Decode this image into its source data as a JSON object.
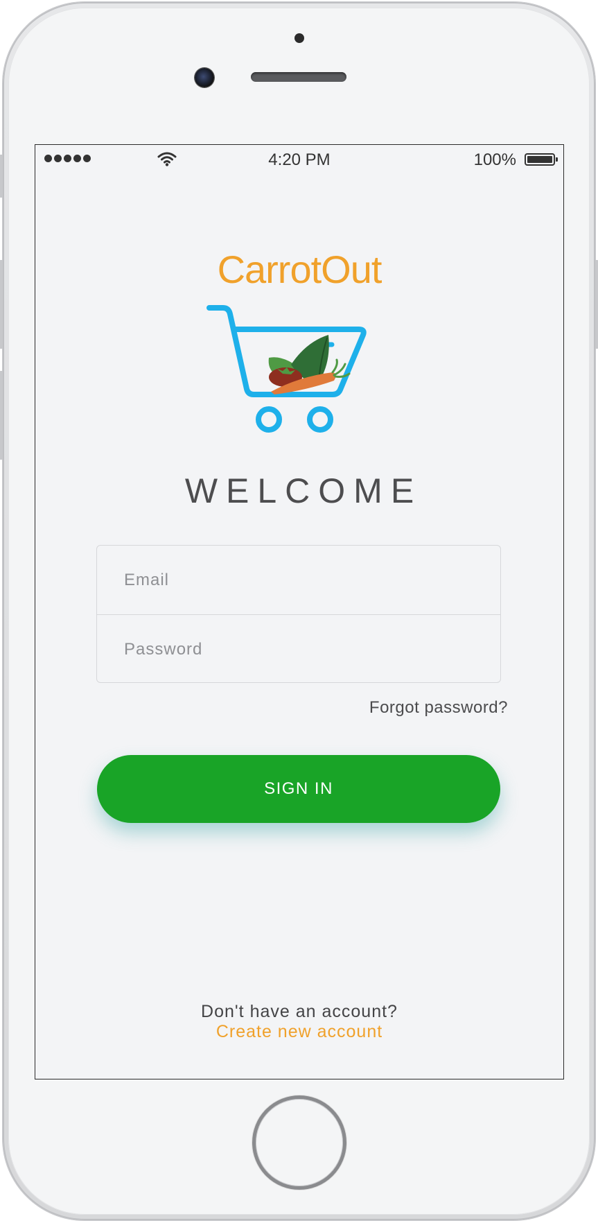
{
  "status_bar": {
    "time": "4:20 PM",
    "battery_percent": "100%",
    "battery_level": 1.0,
    "signal_bars": 5
  },
  "app": {
    "brand_name": "CarrotOut",
    "brand_color": "#f0a12b",
    "logo_icon": "shopping-cart-vegetables-icon",
    "welcome_text": "WELCOME"
  },
  "form": {
    "email_placeholder": "Email",
    "password_placeholder": "Password",
    "forgot_password": "Forgot password?",
    "sign_in_label": "SIGN IN",
    "sign_in_color": "#19a427"
  },
  "footer": {
    "no_account_text": "Don't have an account?",
    "create_account_link": "Create new account"
  }
}
